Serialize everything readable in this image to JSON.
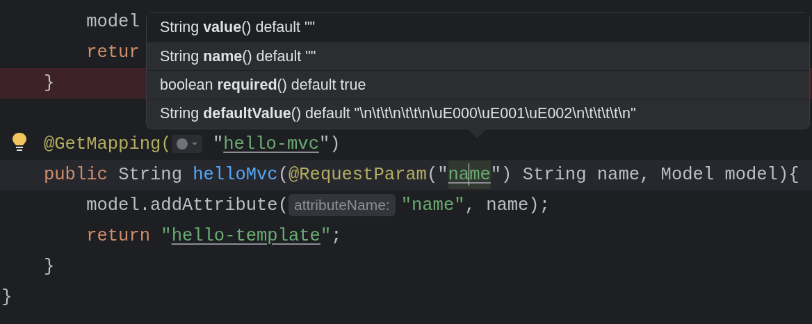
{
  "editor": {
    "lines": [
      {
        "error": false,
        "current": false,
        "tokens": [
          {
            "kind": "plain",
            "text": "    model"
          }
        ]
      },
      {
        "error": false,
        "current": false,
        "tokens": [
          {
            "kind": "keyword",
            "text": "    retur"
          }
        ]
      },
      {
        "error": true,
        "current": false,
        "tokens": [
          {
            "kind": "plain",
            "text": "}"
          }
        ]
      },
      {
        "error": false,
        "current": false
      },
      {
        "error": false,
        "current": false,
        "gutter_icon": true,
        "tokens": [
          {
            "kind": "annotation",
            "text": "@GetMapping("
          },
          {
            "kind": "endpoint_icon"
          },
          {
            "kind": "plain",
            "text": " \""
          },
          {
            "kind": "string_link",
            "text": "hello-mvc"
          },
          {
            "kind": "plain",
            "text": "\")"
          }
        ]
      },
      {
        "error": false,
        "current": true,
        "tokens": [
          {
            "kind": "keyword",
            "text": "public "
          },
          {
            "kind": "plain",
            "text": "String "
          },
          {
            "kind": "method",
            "text": "helloMvc"
          },
          {
            "kind": "plain",
            "text": "("
          },
          {
            "kind": "annotation",
            "text": "@RequestParam"
          },
          {
            "kind": "plain",
            "text": "(\""
          },
          {
            "kind": "string_usage",
            "text": "na"
          },
          {
            "kind": "caret"
          },
          {
            "kind": "string_usage",
            "text": "me"
          },
          {
            "kind": "plain",
            "text": "\") String name, Model model){"
          }
        ]
      },
      {
        "error": false,
        "current": false,
        "tokens": [
          {
            "kind": "plain",
            "text": "    model.addAttribute("
          },
          {
            "kind": "hint",
            "text": "attributeName:"
          },
          {
            "kind": "string",
            "text": "\"name\""
          },
          {
            "kind": "plain",
            "text": ", name);"
          }
        ]
      },
      {
        "error": false,
        "current": false,
        "tokens": [
          {
            "kind": "keyword",
            "text": "    return "
          },
          {
            "kind": "string",
            "text": "\""
          },
          {
            "kind": "string_link",
            "text": "hello-template"
          },
          {
            "kind": "string",
            "text": "\""
          },
          {
            "kind": "plain",
            "text": ";"
          }
        ]
      },
      {
        "error": false,
        "current": false,
        "tokens": [
          {
            "kind": "plain",
            "text": "}"
          }
        ]
      },
      {
        "error": false,
        "current": false,
        "outdent": true,
        "tokens": [
          {
            "kind": "plain",
            "text": "}"
          }
        ]
      }
    ]
  },
  "parameter_info": {
    "items": [
      {
        "text": "String **value**() default \"\"",
        "selected": true
      },
      {
        "text": "String **name**() default \"\"",
        "selected": false
      },
      {
        "text": "boolean **required**() default true",
        "selected": false
      },
      {
        "text": "String **defaultValue**() default \"\\n\\t\\t\\n\\t\\t\\n\\uE000\\uE001\\uE002\\n\\t\\t\\t\\t\\n\"",
        "selected": false
      }
    ]
  }
}
